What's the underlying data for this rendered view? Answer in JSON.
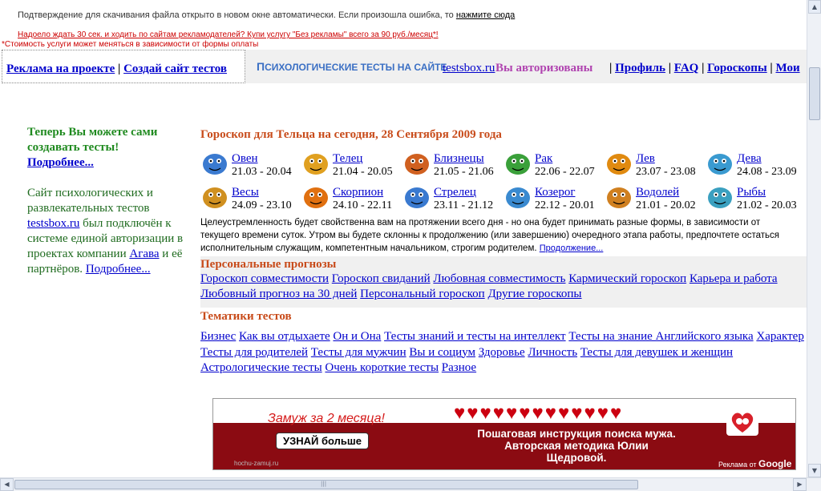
{
  "notice": {
    "text": "Подтверждение для скачивания файла открыто в новом окне автоматически. Если произошла ошибка, то",
    "link": "нажмите сюда",
    "ad_offer": "Надоело ждать 30 сек. и ходить по сайтам рекламодателей? Купи услугу \"Без рекламы\" всего за 90 руб./месяц*!",
    "ad_note": "*Стоимость услуги может меняться в зависимости от формы оплаты"
  },
  "topbar": {
    "left_links": [
      "Реклама на проекте",
      "Создай сайт тестов"
    ],
    "separator": "|",
    "brand_cap": "П",
    "brand_rest": "СИХОЛОГИЧЕСКИЕ ТЕСТЫ НА САЙТЕ",
    "site": "testsbox.ru",
    "auth": "Вы авторизованы",
    "menu": [
      "Профиль",
      "FAQ",
      "Гороскопы",
      "Мои"
    ]
  },
  "sidebar": {
    "head": "Теперь Вы можете сами создавать тесты!",
    "more1": "Подробнее...",
    "p_start": "Сайт психологических и развлекательных тестов",
    "site": "testsbox.ru",
    "p_mid": "был подключён к системе единой авторизации в проектах компании",
    "agava": "Агава",
    "p_end": "и её партнёров.",
    "more2": "Подробнее..."
  },
  "horoscope": {
    "title": "Гороскоп для Тельца на сегодня, 28 Сентября 2009 года",
    "signs": [
      {
        "name": "Овен",
        "dates": "21.03 - 20.04",
        "icon": "ram-icon",
        "color": "#3a7ad0"
      },
      {
        "name": "Телец",
        "dates": "21.04 - 20.05",
        "icon": "bull-icon",
        "color": "#e0a020"
      },
      {
        "name": "Близнецы",
        "dates": "21.05 - 21.06",
        "icon": "twins-icon",
        "color": "#d06020"
      },
      {
        "name": "Рак",
        "dates": "22.06 - 22.07",
        "icon": "crab-icon",
        "color": "#3aa03a"
      },
      {
        "name": "Лев",
        "dates": "23.07 - 23.08",
        "icon": "lion-icon",
        "color": "#e08a10"
      },
      {
        "name": "Дева",
        "dates": "24.08 - 23.09",
        "icon": "maiden-icon",
        "color": "#3a9ad0"
      },
      {
        "name": "Весы",
        "dates": "24.09 - 23.10",
        "icon": "scales-icon",
        "color": "#d09020"
      },
      {
        "name": "Скорпион",
        "dates": "24.10 - 22.11",
        "icon": "scorpion-icon",
        "color": "#e07010"
      },
      {
        "name": "Стрелец",
        "dates": "23.11 - 21.12",
        "icon": "archer-icon",
        "color": "#3a7ad0"
      },
      {
        "name": "Козерог",
        "dates": "22.12 - 20.01",
        "icon": "goat-icon",
        "color": "#3a8ad0"
      },
      {
        "name": "Водолей",
        "dates": "21.01 - 20.02",
        "icon": "water-bearer-icon",
        "color": "#d08020"
      },
      {
        "name": "Рыбы",
        "dates": "21.02 - 20.03",
        "icon": "fish-icon",
        "color": "#3aa0c0"
      }
    ],
    "desc_1": "Целеустремленность будет свойственна вам на протяжении всего дня - но она будет принимать разные формы, в зависимости от",
    "desc_2": "текущего времени суток. Утром вы будете склонны к продолжению (или завершению) очередного этапа работы, предпочтете остаться",
    "desc_3": "исполнительным служащим, компетентным начальником, строгим родителем.",
    "more": "Продолжение..."
  },
  "personal": {
    "title": "Персональные прогнозы",
    "links": [
      "Гороскоп совместимости",
      "Гороскоп свиданий",
      "Любовная совместимость",
      "Кармический гороскоп",
      "Карьера и работа",
      "Любовный прогноз на 30 дней",
      "Персональный гороскоп",
      "Другие гороскопы"
    ]
  },
  "topics": {
    "title": "Тематики тестов",
    "links": [
      "Бизнес",
      "Как вы отдыхаете",
      "Он и Она",
      "Тесты знаний и тесты на интеллект",
      "Тесты на знание Английского языка",
      "Характер",
      "Тесты для родителей",
      "Тесты для мужчин",
      "Вы и социум",
      "Здоровье",
      "Личность",
      "Тесты для девушек и женщин",
      "Астрологические тесты",
      "Очень короткие тесты",
      "Разное"
    ]
  },
  "ad": {
    "title": "Замуж за 2 месяца!",
    "button": "УЗНАЙ больше",
    "text": "Пошаговая инструкция поиска мужа. Авторская методика Юлии Щедровой.",
    "site": "hochu-zamuj.ru",
    "ads_label": "Реклама от",
    "ads_brand": "Google",
    "hearts": "♥♥♥♥♥♥♥♥♥♥♥♥♥"
  },
  "scroll": {
    "up": "▲",
    "down": "▼",
    "left": "◀",
    "right": "▶",
    "grip": "|||"
  }
}
